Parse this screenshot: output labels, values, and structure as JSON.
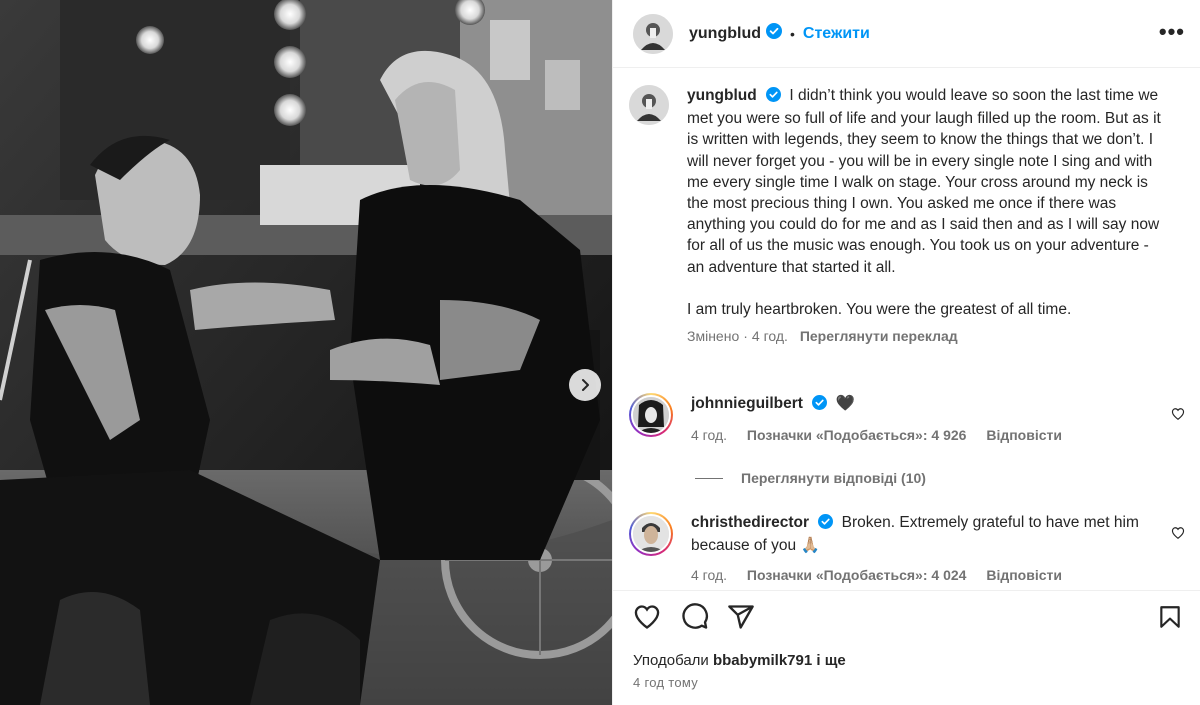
{
  "post": {
    "username": "yungblud",
    "follow_label": "Стежити",
    "separator": "•",
    "more_label": "•••"
  },
  "caption": {
    "username": "yungblud",
    "text": "I didn’t think you would leave so soon the last time we met you were so full of life and your laugh filled up the room.  But as it is written with legends, they seem to know the things that we don’t. I will never forget you - you will be in every single note I sing and with me every single time I walk on stage. Your cross around my neck is the most precious thing I own. You asked me once if there was anything you could do for me and as I said then and as I will say now for all of us the music was enough. You took us on your adventure - an adventure that started it all.",
    "text2": "I am truly heartbroken. You were the greatest of all time.",
    "edited": "Змінено",
    "time": "4 год.",
    "translate": "Переглянути переклад"
  },
  "comments": [
    {
      "username": "johnnieguilbert",
      "text": "🖤",
      "time": "4 год.",
      "likes": "Позначки «Подобається»: 4 926",
      "reply": "Відповісти"
    },
    {
      "username": "christhedirector",
      "text": "Broken. Extremely grateful to have met him because of you 🙏🏼",
      "time": "4 год.",
      "likes": "Позначки «Подобається»: 4 024",
      "reply": "Відповісти"
    }
  ],
  "replies_label": "Переглянути відповіді (10)",
  "footer": {
    "liked_by_prefix": "Уподобали",
    "liked_by_user": "bbabymilk791",
    "liked_by_suffix": "і ще",
    "time_ago": "4 год тому"
  },
  "icons": [
    "chevron-right-icon",
    "verified-badge-icon",
    "heart-icon",
    "comment-icon",
    "share-icon",
    "bookmark-icon",
    "more-icon"
  ],
  "colors": {
    "accent": "#0095f6",
    "muted": "#737373",
    "text": "#262626",
    "verified": "#0095f6"
  }
}
